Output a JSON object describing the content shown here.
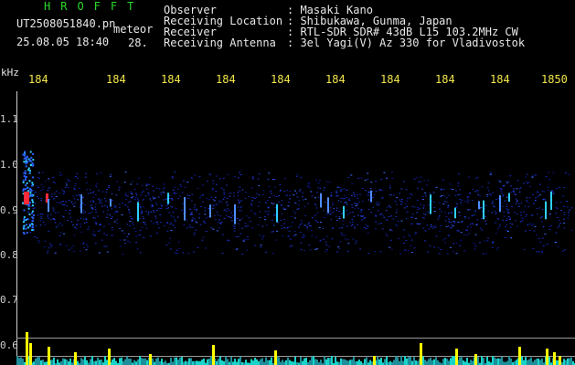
{
  "header": {
    "brand": "HROFFT",
    "filename": "UT2508051840.pn",
    "datetime": "25.08.05 18:40",
    "meteor_label": "meteor",
    "meteor_count": "28."
  },
  "info": [
    {
      "key": "Observer",
      "value": ": Masaki Kano"
    },
    {
      "key": "Receiving Location",
      "value": ": Shibukawa, Gunma, Japan"
    },
    {
      "key": "Receiver",
      "value": ": RTL-SDR SDR# 43dB L15 103.2MHz CW"
    },
    {
      "key": "Receiving Antenna",
      "value": ": 3el Yagi(V) Az 330 for Vladivostok"
    }
  ],
  "y_axis": {
    "unit": "kHz",
    "ticks": [
      "1.1",
      "1.0",
      "0.9",
      "0.8",
      "0.7",
      "0.6"
    ]
  },
  "time_axis": {
    "labels": [
      "184",
      "184",
      "184",
      "184",
      "184",
      "184",
      "184",
      "184",
      "184",
      "1850"
    ]
  },
  "colors": {
    "header_brand": "#2bd82b",
    "time_labels": "#f2e64a",
    "text": "#e8e8e8",
    "echo_strong": "#ff2a3a",
    "echo_mid": "#2fd0ff",
    "noise_band": "#1a2bb8",
    "bottom_noise": "#18d3c8",
    "spike": "#ffff00"
  }
}
